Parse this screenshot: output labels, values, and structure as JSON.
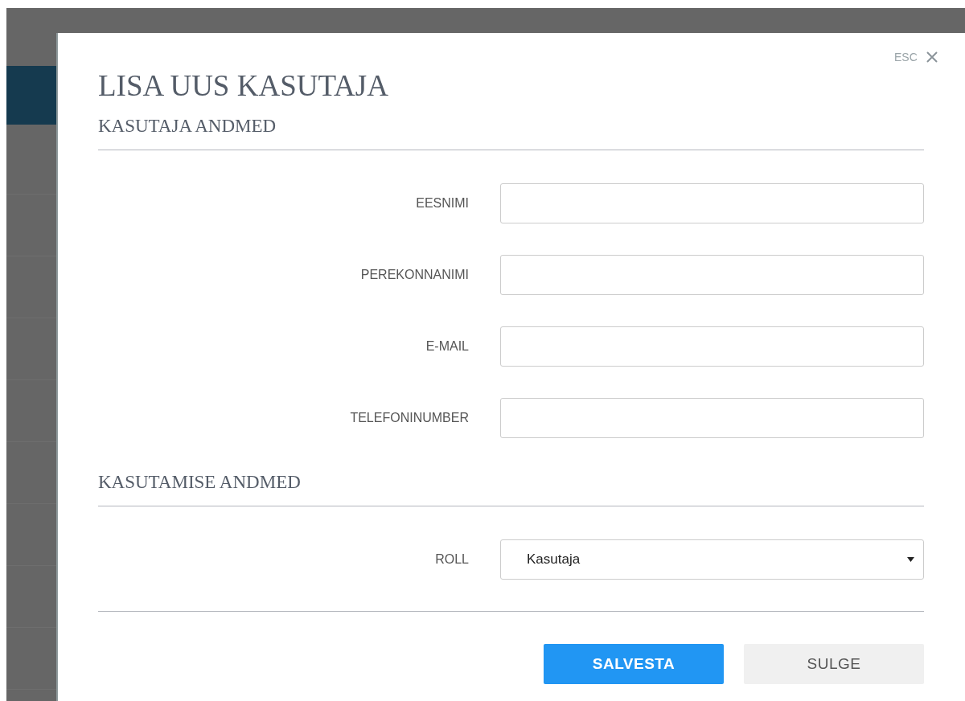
{
  "dialog": {
    "title": "LISA UUS KASUTAJA",
    "close_hint": "ESC",
    "sections": [
      {
        "heading": "KASUTAJA ANDMED",
        "fields": [
          {
            "label": "EESNIMI",
            "kind": "text"
          },
          {
            "label": "PEREKONNANIMI",
            "kind": "text"
          },
          {
            "label": "E-MAIL",
            "kind": "text"
          },
          {
            "label": "TELEFONINUMBER",
            "kind": "text"
          }
        ]
      },
      {
        "heading": "KASUTAMISE ANDMED",
        "fields": [
          {
            "label": "ROLL",
            "kind": "select",
            "value": "Kasutaja"
          }
        ]
      }
    ],
    "buttons": [
      {
        "label": "SALVESTA",
        "kind": "primary"
      },
      {
        "label": "SULGE",
        "kind": "secondary"
      }
    ]
  }
}
